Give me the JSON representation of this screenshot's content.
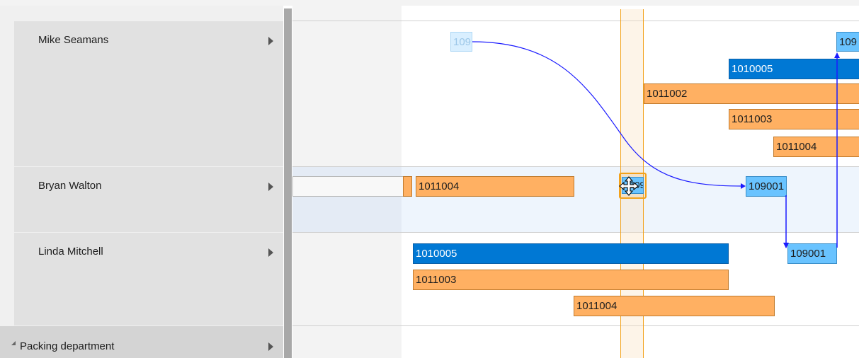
{
  "resources": [
    {
      "name": "Mike Seamans"
    },
    {
      "name": "Bryan Walton"
    },
    {
      "name": "Linda Mitchell"
    }
  ],
  "group": {
    "name": "Packing department"
  },
  "bars": {
    "mike": [
      {
        "label": "109",
        "kind": "ghost"
      },
      {
        "label": "109",
        "kind": "lightblue"
      },
      {
        "label": "1010005",
        "kind": "blue"
      },
      {
        "label": "1011002",
        "kind": "orange"
      },
      {
        "label": "1011003",
        "kind": "orange"
      },
      {
        "label": "1011004",
        "kind": "orange"
      }
    ],
    "bryan": [
      {
        "label": "",
        "kind": "white"
      },
      {
        "label": "1011004",
        "kind": "orange"
      },
      {
        "label": "109",
        "kind": "lightblue-dragging"
      },
      {
        "label": "109001",
        "kind": "lightblue"
      }
    ],
    "linda": [
      {
        "label": "1010005",
        "kind": "blue"
      },
      {
        "label": "1011003",
        "kind": "orange"
      },
      {
        "label": "1011004",
        "kind": "orange"
      },
      {
        "label": "109001",
        "kind": "lightblue"
      }
    ]
  },
  "colors": {
    "orange": "#ffb062",
    "blue": "#0078d4",
    "lightblue": "#69c3ff",
    "dependency_link": "#1a1aff",
    "time_marker": "#f3a21c"
  },
  "icons": [
    "expander-triangle-icon",
    "chevron-right-icon",
    "move-cursor-icon"
  ]
}
